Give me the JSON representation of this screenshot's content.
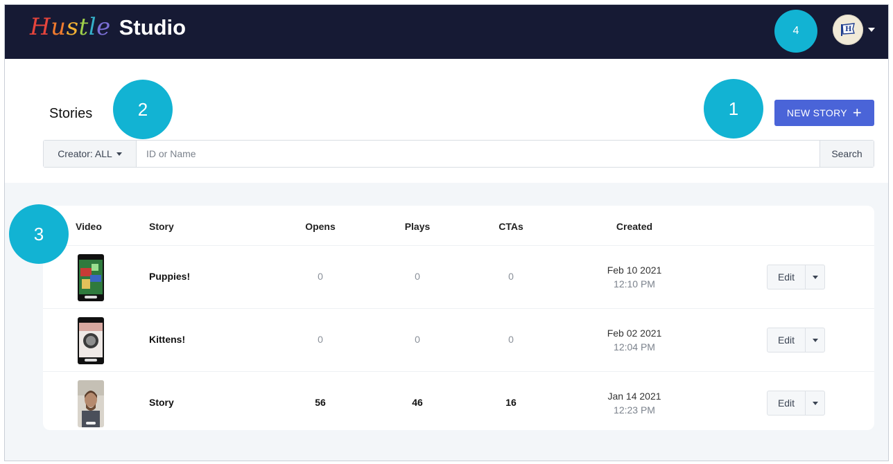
{
  "header": {
    "logo_hustle": "Hustle",
    "logo_studio": "Studio",
    "avatar_icon": "flag-h-icon"
  },
  "callouts": [
    "1",
    "2",
    "3",
    "4"
  ],
  "page": {
    "title": "Stories",
    "new_story_label": "NEW STORY",
    "new_story_icon": "plus-icon"
  },
  "search": {
    "creator_label": "Creator: ALL",
    "placeholder": "ID or Name",
    "button_label": "Search"
  },
  "table": {
    "columns": [
      "Video",
      "Story",
      "Opens",
      "Plays",
      "CTAs",
      "Created"
    ],
    "rows": [
      {
        "story": "Puppies!",
        "opens": "0",
        "plays": "0",
        "ctas": "0",
        "date": "Feb 10 2021",
        "time": "12:10 PM",
        "edit": "Edit"
      },
      {
        "story": "Kittens!",
        "opens": "0",
        "plays": "0",
        "ctas": "0",
        "date": "Feb 02 2021",
        "time": "12:04 PM",
        "edit": "Edit"
      },
      {
        "story": "Story",
        "opens": "56",
        "plays": "46",
        "ctas": "16",
        "date": "Jan 14 2021",
        "time": "12:23 PM",
        "edit": "Edit"
      }
    ]
  },
  "colors": {
    "topbar": "#161a34",
    "accent": "#4a64d8",
    "callout": "#12b3d3"
  }
}
